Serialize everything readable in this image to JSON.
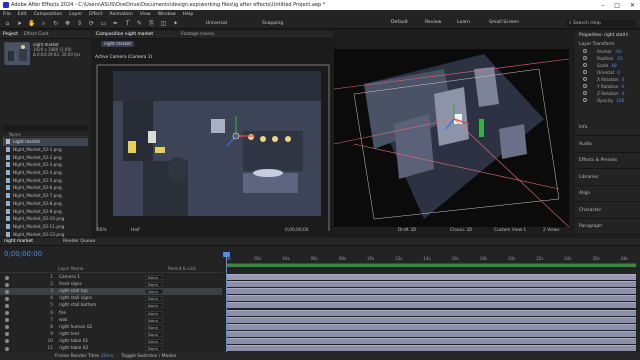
{
  "titlebar": {
    "title": "Adobe After Effects 2024 - C:\\Users\\ASUS\\OneDrive\\Documents\\design.exp\\working files\\ig after effects\\Untitled Project.aep *"
  },
  "menu": [
    "File",
    "Edit",
    "Composition",
    "Layer",
    "Effect",
    "Animation",
    "View",
    "Window",
    "Help"
  ],
  "toolbar": {
    "universal": "Universal",
    "snapping": "Snapping"
  },
  "workspaces": [
    "Default",
    "Review",
    "Learn",
    "Small Screen"
  ],
  "search_placeholder": "Search Help",
  "project": {
    "tabs": [
      "Project",
      "Effect Cont"
    ],
    "comp_name": "night market",
    "comp_info": [
      "1920 x 1080 (1.00)",
      "Δ 0;00;29;02, 30.00 fps"
    ],
    "col_name": "Name",
    "items": [
      "night market",
      "Night_Market_02-1.png",
      "Night_Market_02-2.png",
      "Night_Market_02-3.png",
      "Night_Market_02-4.png",
      "Night_Market_02-5.png",
      "Night_Market_02-6.png",
      "Night_Market_02-7.png",
      "Night_Market_02-8.png",
      "Night_Market_02-9.png",
      "Night_Market_02-10.png",
      "Night_Market_02-11.png",
      "Night_Market_02-12.png",
      "Night_Market_02-13.png",
      "Night_Market_02-14.png"
    ],
    "footer": "8 bpc"
  },
  "comp": {
    "tab": "Composition night market",
    "footage_tab": "Footage (none)",
    "breadcrumb": "night market",
    "active_camera": "Active Camera (Camera 1)",
    "custom_view": "Custom View 1",
    "zoom": "50%",
    "quality": "Half",
    "timecode": "0;00;00;00",
    "renderer": "Draft 3D",
    "classic": "Classic 3D",
    "view_sel": "Custom View 1",
    "views": "2 Views"
  },
  "right_panel": {
    "title": "Properties: right stall t",
    "group": "Layer Transform",
    "props": [
      {
        "label": "Anchor",
        "value": "-93"
      },
      {
        "label": "Position",
        "value": "-51"
      },
      {
        "label": "Scale",
        "value": "48"
      },
      {
        "label": "Orientat",
        "value": "0"
      },
      {
        "label": "X Rotation",
        "value": "0"
      },
      {
        "label": "Y Rotation",
        "value": "0"
      },
      {
        "label": "Z Rotation",
        "value": "0"
      },
      {
        "label": "Opacity",
        "value": "100"
      }
    ],
    "sections": [
      "Info",
      "Audio",
      "Effects & Presets",
      "Libraries",
      "Align",
      "Character",
      "Paragraph",
      "Tracker",
      "Content-Aware Fill"
    ]
  },
  "timeline": {
    "tabs": [
      "night market",
      "Render Queue"
    ],
    "timecode": "0;00;00;00",
    "headers": {
      "layer_name": "Layer Name",
      "parent": "Parent & Link"
    },
    "layers": [
      {
        "num": "1",
        "name": "Camera 1",
        "parent": "None"
      },
      {
        "num": "2",
        "name": "front signs",
        "parent": "None"
      },
      {
        "num": "3",
        "name": "right stall top",
        "parent": "None"
      },
      {
        "num": "4",
        "name": "right stall signs",
        "parent": "None"
      },
      {
        "num": "5",
        "name": "right stall bottom",
        "parent": "None"
      },
      {
        "num": "6",
        "name": "fire",
        "parent": "None"
      },
      {
        "num": "7",
        "name": "wok",
        "parent": "None"
      },
      {
        "num": "8",
        "name": "right human 02",
        "parent": "None"
      },
      {
        "num": "9",
        "name": "right tent",
        "parent": "None"
      },
      {
        "num": "10",
        "name": "right table 01",
        "parent": "None"
      },
      {
        "num": "11",
        "name": "right table 02",
        "parent": "None"
      }
    ],
    "ruler": [
      "0s",
      "02s",
      "04s",
      "06s",
      "08s",
      "10s",
      "12s",
      "14s",
      "16s",
      "18s",
      "20s",
      "22s",
      "24s",
      "26s",
      "28s"
    ],
    "frame_render": "Frame Render Time",
    "frame_render_val": "20ms",
    "toggle": "Toggle Switches / Modes"
  },
  "colors": {
    "accent": "#4a8ef0",
    "bar": "#8c8fa8",
    "work_area": "#3a8a3a"
  }
}
